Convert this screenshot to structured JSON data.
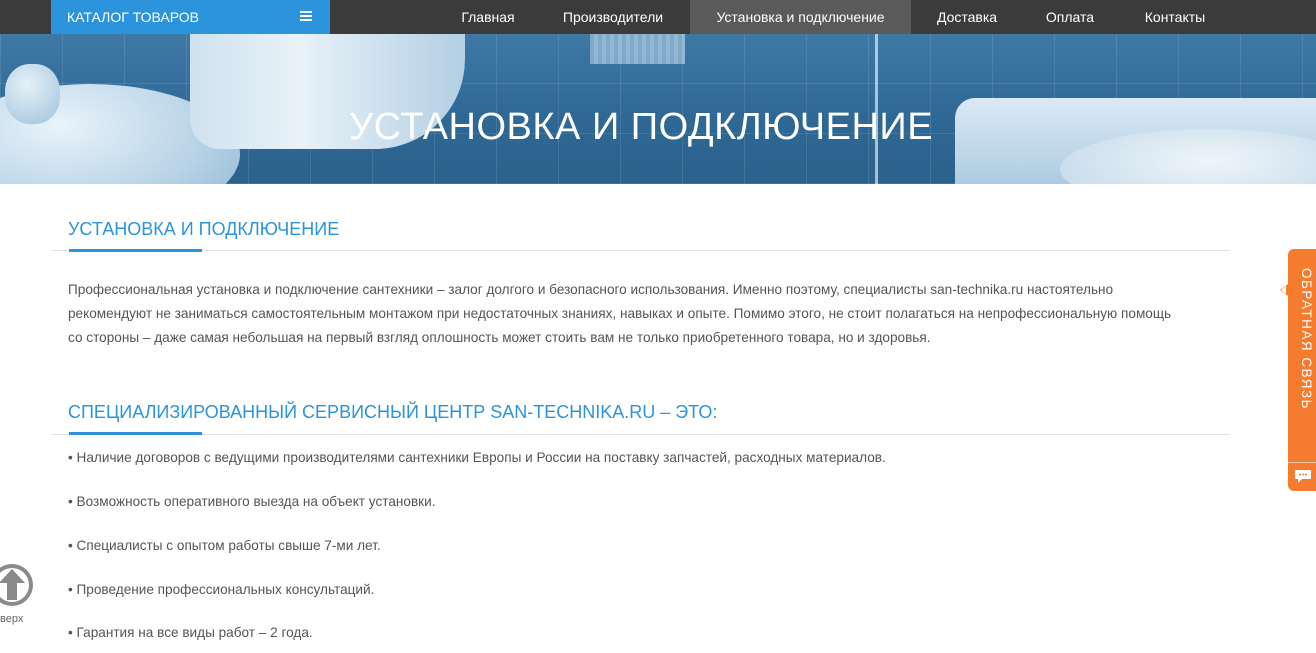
{
  "topbar": {
    "catalog_label": "КАТАЛОГ ТОВАРОВ",
    "nav": [
      {
        "label": "Главная"
      },
      {
        "label": "Производители"
      },
      {
        "label": "Установка и подключение",
        "active": true
      },
      {
        "label": "Доставка"
      },
      {
        "label": "Оплата"
      },
      {
        "label": "Контакты"
      }
    ]
  },
  "hero": {
    "title": "УСТАНОВКА И ПОДКЛЮЧЕНИЕ"
  },
  "main": {
    "heading": "УСТАНОВКА И ПОДКЛЮЧЕНИЕ",
    "paragraph": "Профессиональная установка и подключение сантехники – залог долгого и безопасного использования. Именно поэтому, специалисты san-technika.ru настоятельно рекомендуют не заниматься самостоятельным монтажом при недостаточных знаниях, навыках и опыте. Помимо этого, не стоит полагаться на непрофессиональную помощь со стороны – даже самая небольшая на первый взгляд оплошность может стоить вам не только приобретенного товара, но и здоровья.",
    "service_heading": "СПЕЦИАЛИЗИРОВАННЫЙ СЕРВИСНЫЙ ЦЕНТР SAN-TECHNIKA.RU – ЭТО:",
    "bullets": [
      "• Наличие договоров с ведущими производителями сантехники Европы и России на поставку запчастей, расходных материалов.",
      "• Возможность оперативного выезда на объект установки.",
      "• Специалисты с опытом работы свыше 7-ми лет.",
      "• Проведение профессиональных консультаций.",
      "• Гарантия на все виды работ – 2 года."
    ]
  },
  "feedback": {
    "label": "ОБРАТНАЯ СВЯЗЬ"
  },
  "totop": {
    "label": "верх"
  },
  "colors": {
    "accent": "#2b94dd",
    "topbar": "#3b3b3b",
    "feedback": "#f57b2e"
  },
  "icons": {
    "menu": "hamburger-icon",
    "chat": "chat-bubble-icon",
    "totop": "arrow-up-circle-icon"
  }
}
